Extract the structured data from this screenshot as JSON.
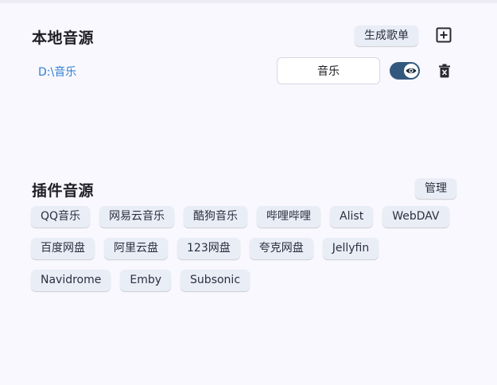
{
  "local": {
    "title": "本地音源",
    "generate_playlist_label": "生成歌单",
    "add_icon": "add-box-icon",
    "entry": {
      "path": "D:\\音乐",
      "name_value": "音乐",
      "visible": true,
      "toggle_icon": "eye-icon",
      "delete_icon": "trash-icon"
    }
  },
  "plugins": {
    "title": "插件音源",
    "manage_label": "管理",
    "rows": [
      [
        "QQ音乐",
        "网易云音乐",
        "酷狗音乐",
        "哔哩哔哩",
        "Alist",
        "WebDAV"
      ],
      [
        "百度网盘",
        "阿里云盘",
        "123网盘",
        "夸克网盘",
        "Jellyfin"
      ],
      [
        "Navidrome",
        "Emby",
        "Subsonic"
      ]
    ]
  },
  "colors": {
    "accent": "#33587e",
    "link": "#2f7fd0",
    "chip_bg": "#e9edf6",
    "page_bg": "#f8f8fe"
  }
}
